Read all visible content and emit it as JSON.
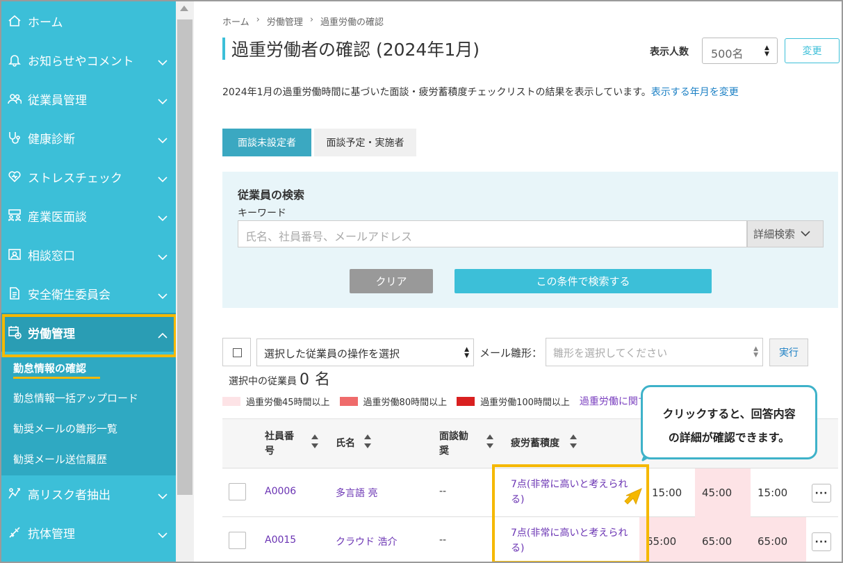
{
  "sidebar": {
    "items": [
      {
        "label": "ホーム",
        "icon": "home-icon"
      },
      {
        "label": "お知らせやコメント",
        "icon": "bell-icon"
      },
      {
        "label": "従業員管理",
        "icon": "people-icon"
      },
      {
        "label": "健康診断",
        "icon": "stethoscope-icon"
      },
      {
        "label": "ストレスチェック",
        "icon": "heart-icon"
      },
      {
        "label": "産業医面談",
        "icon": "meeting-icon"
      },
      {
        "label": "相談窓口",
        "icon": "consult-icon"
      },
      {
        "label": "安全衛生委員会",
        "icon": "document-icon"
      },
      {
        "label": "労働管理",
        "icon": "calendar-clock-icon"
      },
      {
        "label": "高リスク者抽出",
        "icon": "risk-icon"
      },
      {
        "label": "抗体管理",
        "icon": "syringe-icon"
      }
    ],
    "submenu": [
      {
        "label": "勤怠情報の確認"
      },
      {
        "label": "勤怠情報一括アップロード"
      },
      {
        "label": "勧奨メールの雛形一覧"
      },
      {
        "label": "勧奨メール送信履歴"
      }
    ]
  },
  "breadcrumb": [
    "ホーム",
    "労働管理",
    "過重労働の確認"
  ],
  "page_title": "過重労働者の確認 (2024年1月)",
  "display_count": {
    "label": "表示人数",
    "value": "500名",
    "button": "変更"
  },
  "description": {
    "text": "2024年1月の過重労働時間に基づいた面談・疲労蓄積度チェックリストの結果を表示しています。",
    "link": "表示する年月を変更"
  },
  "tabs": [
    {
      "label": "面談未設定者",
      "active": true
    },
    {
      "label": "面談予定・実施者",
      "active": false
    }
  ],
  "search": {
    "title": "従業員の検索",
    "keyword_label": "キーワード",
    "placeholder": "氏名、社員番号、メールアドレス",
    "advanced": "詳細検索",
    "clear": "クリア",
    "submit": "この条件で検索する"
  },
  "bulk": {
    "action_placeholder": "選択した従業員の操作を選択",
    "mail_label": "メール雛形：",
    "mail_placeholder": "雛形を選択してください",
    "run": "実行",
    "selected_label": "選択中の従業員",
    "selected_count": "0",
    "selected_unit": "名"
  },
  "legend": [
    {
      "label": "過重労働45時間以上",
      "color": "#fde3e6"
    },
    {
      "label": "過重労働80時間以上",
      "color": "#ef6b6b"
    },
    {
      "label": "過重労働100時間以上",
      "color": "#d92020"
    }
  ],
  "legend_link": "過重労働に関す",
  "table": {
    "headers": {
      "id": "社員番号",
      "name": "氏名",
      "interview": "面談勧奨",
      "fatigue": "疲労蓄積度"
    },
    "rows": [
      {
        "id": "A0006",
        "name": "多言語 亮",
        "interview": "--",
        "fatigue": "7点(非常に高いと考えられる)",
        "h1": "15:00",
        "h2": "45:00",
        "h3": "15:00"
      },
      {
        "id": "A0015",
        "name": "クラウド 浩介",
        "interview": "--",
        "fatigue": "7点(非常に高いと考えられる)",
        "h1": "65:00",
        "h2": "65:00",
        "h3": "65:00"
      }
    ],
    "more_label": "···"
  },
  "callout": {
    "line1": "クリックすると、回答内容",
    "line2": "の詳細が確認できます。"
  },
  "colors": {
    "accent": "#3cbfd8",
    "highlight": "#f5b800",
    "link": "#6a33b3",
    "pink": "#fde3e6"
  }
}
